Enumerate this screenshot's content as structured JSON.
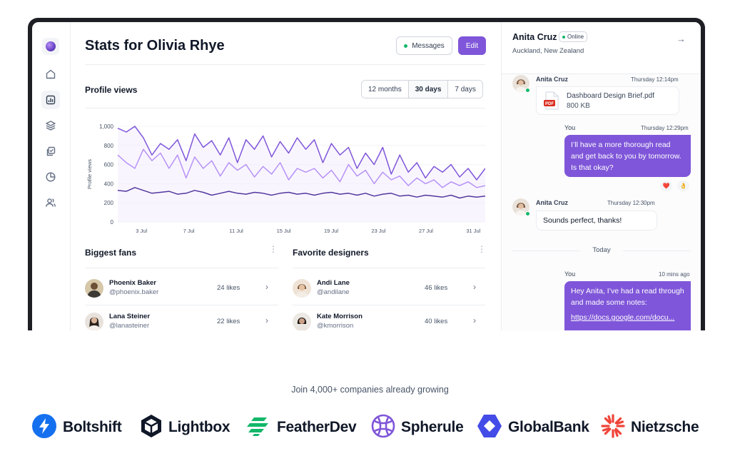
{
  "header": {
    "title": "Stats for Olivia Rhye",
    "messages_label": "Messages",
    "edit_label": "Edit"
  },
  "sidebar": {
    "icons": [
      "home-icon",
      "bar-chart-icon",
      "layers-icon",
      "check-square-icon",
      "pie-chart-icon",
      "users-icon"
    ],
    "active": "bar-chart-icon"
  },
  "profile_views": {
    "title": "Profile views",
    "tabs": [
      "12 months",
      "30 days",
      "7 days"
    ],
    "selected_tab": "30 days"
  },
  "chart_data": {
    "type": "line",
    "title": "Profile views",
    "ylabel": "Profile views",
    "xlabel": "",
    "ylim": [
      0,
      1000
    ],
    "y_ticks": [
      "1,000",
      "800",
      "600",
      "400",
      "200",
      "0"
    ],
    "x_ticks": [
      "3 Jul",
      "7 Jul",
      "11 Jul",
      "15 Jul",
      "19 Jul",
      "23 Jul",
      "27 Jul",
      "31 Jul"
    ],
    "x_range": [
      1,
      32
    ],
    "series": [
      {
        "color": "#7f56d9",
        "values": [
          980,
          940,
          1000,
          880,
          700,
          820,
          760,
          860,
          640,
          920,
          780,
          850,
          700,
          880,
          620,
          860,
          760,
          900,
          680,
          840,
          720,
          880,
          760,
          860,
          620,
          820,
          700,
          780,
          560,
          720,
          600,
          780,
          500,
          700,
          520,
          620,
          460,
          580,
          520,
          600,
          470,
          560,
          440,
          560
        ]
      },
      {
        "color": "#b692f6",
        "values": [
          700,
          620,
          560,
          760,
          640,
          720,
          560,
          700,
          460,
          680,
          560,
          640,
          480,
          620,
          540,
          600,
          470,
          580,
          500,
          620,
          440,
          560,
          520,
          560,
          460,
          540,
          420,
          600,
          480,
          540,
          400,
          520,
          440,
          480,
          380,
          460,
          400,
          440,
          360,
          420,
          380,
          420,
          360,
          380
        ]
      },
      {
        "color": "#53389e",
        "values": [
          330,
          320,
          360,
          330,
          300,
          310,
          320,
          290,
          300,
          330,
          310,
          280,
          300,
          320,
          300,
          290,
          310,
          300,
          280,
          300,
          310,
          290,
          300,
          280,
          300,
          310,
          290,
          300,
          280,
          300,
          270,
          290,
          300,
          270,
          280,
          260,
          280,
          270,
          260,
          280,
          250,
          270,
          260,
          270
        ]
      }
    ]
  },
  "fans": {
    "title": "Biggest fans",
    "items": [
      {
        "name": "Phoenix Baker",
        "handle": "@phoenix.baker",
        "likes": "24 likes"
      },
      {
        "name": "Lana Steiner",
        "handle": "@lanasteiner",
        "likes": "22 likes"
      }
    ]
  },
  "designers": {
    "title": "Favorite designers",
    "items": [
      {
        "name": "Andi Lane",
        "handle": "@andilane",
        "likes": "46 likes"
      },
      {
        "name": "Kate Morrison",
        "handle": "@kmorrison",
        "likes": "40 likes"
      }
    ]
  },
  "chat": {
    "contact": "Anita Cruz",
    "status": "Online",
    "location": "Auckland, New Zealand",
    "messages": [
      {
        "sender": "Anita Cruz",
        "time": "Thursday 12:14pm",
        "file_name": "Dashboard Design Brief.pdf",
        "file_size": "800 KB",
        "file_type": "PDF"
      },
      {
        "sender": "You",
        "time": "Thursday 12:29pm",
        "text": "I’ll have a more thorough read and get back to you by tomorrow. Is that okay?",
        "reactions": [
          "❤️",
          "👌"
        ]
      },
      {
        "sender": "Anita Cruz",
        "time": "Thursday 12:30pm",
        "text": "Sounds perfect, thanks!"
      },
      {
        "sender": "You",
        "time": "10 mins ago",
        "text": "Hey Anita, I’ve had a read through and made some notes:",
        "link": "https://docs.google.com/docu..."
      }
    ],
    "divider": "Today"
  },
  "footer": {
    "tagline": "Join 4,000+ companies already growing",
    "brands": [
      {
        "name": "Boltshift",
        "icon": "bolt-icon",
        "color": "#1570ef"
      },
      {
        "name": "Lightbox",
        "icon": "cube-icon",
        "color": "#101828"
      },
      {
        "name": "FeatherDev",
        "icon": "feather-icon",
        "color": "#12b76a"
      },
      {
        "name": "Spherule",
        "icon": "sphere-icon",
        "color": "#7f56d9"
      },
      {
        "name": "GlobalBank",
        "icon": "hexagon-icon",
        "color": "#444ce7"
      },
      {
        "name": "Nietzsche",
        "icon": "sunburst-icon",
        "color": "#f04438"
      }
    ]
  }
}
